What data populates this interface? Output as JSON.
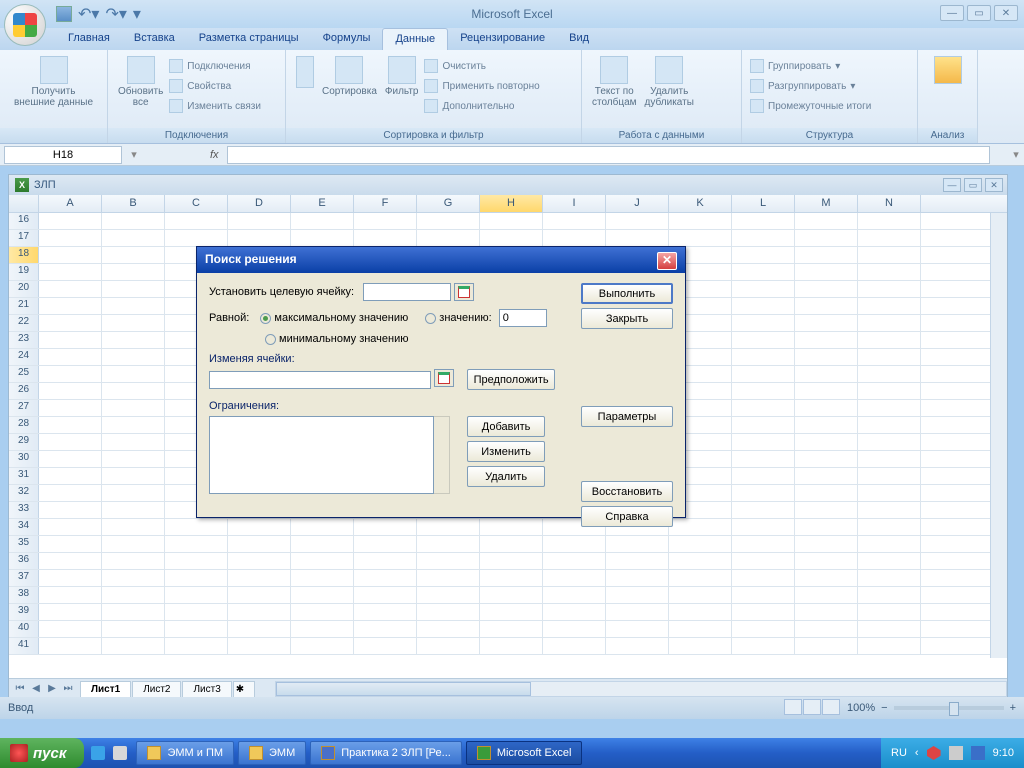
{
  "app_title": "Microsoft Excel",
  "tabs": [
    "Главная",
    "Вставка",
    "Разметка страницы",
    "Формулы",
    "Данные",
    "Рецензирование",
    "Вид"
  ],
  "active_tab": "Данные",
  "ribbon": {
    "group1": {
      "title": "",
      "btn1": "Получить\nвнешние данные"
    },
    "group2": {
      "title": "Подключения",
      "btn": "Обновить\nвсе",
      "i1": "Подключения",
      "i2": "Свойства",
      "i3": "Изменить связи"
    },
    "group3": {
      "title": "Сортировка и фильтр",
      "btn1": "Сортировка",
      "btn2": "Фильтр",
      "i1": "Очистить",
      "i2": "Применить повторно",
      "i3": "Дополнительно"
    },
    "group4": {
      "title": "Работа с данными",
      "btn1": "Текст по\nстолбцам",
      "btn2": "Удалить\nдубликаты"
    },
    "group5": {
      "title": "Структура",
      "i1": "Группировать",
      "i2": "Разгруппировать",
      "i3": "Промежуточные итоги"
    },
    "group6": {
      "title": "Анализ"
    }
  },
  "namebox": "H18",
  "workbook_title": "ЗЛП",
  "columns": [
    "A",
    "B",
    "C",
    "D",
    "E",
    "F",
    "G",
    "H",
    "I",
    "J",
    "K",
    "L",
    "M",
    "N"
  ],
  "rows": [
    16,
    17,
    18,
    19,
    20,
    21,
    22,
    23,
    24,
    25,
    26,
    27,
    28,
    29,
    30,
    31,
    32,
    33,
    34,
    35,
    36,
    37,
    38,
    39,
    40,
    41
  ],
  "selected_cell": {
    "row": 18,
    "col": "H"
  },
  "sheets": [
    "Лист1",
    "Лист2",
    "Лист3"
  ],
  "status": "Ввод",
  "zoom": "100%",
  "dialog": {
    "title": "Поиск решения",
    "target_label": "Установить целевую ячейку:",
    "target_value": "",
    "equal": "Равной:",
    "r_max": "максимальному значению",
    "r_val": "значению:",
    "r_min": "минимальному значению",
    "val_input": "0",
    "changing": "Изменяя ячейки:",
    "changing_value": "",
    "suggest": "Предположить",
    "constraints": "Ограничения:",
    "add": "Добавить",
    "edit": "Изменить",
    "del": "Удалить",
    "run": "Выполнить",
    "close": "Закрыть",
    "params": "Параметры",
    "reset": "Восстановить",
    "help": "Справка"
  },
  "taskbar": {
    "start": "пуск",
    "items": [
      "ЭММ и ПМ",
      "ЭММ",
      "Практика 2 ЗЛП [Ре...",
      "Microsoft Excel"
    ],
    "lang": "RU",
    "clock": "9:10"
  }
}
